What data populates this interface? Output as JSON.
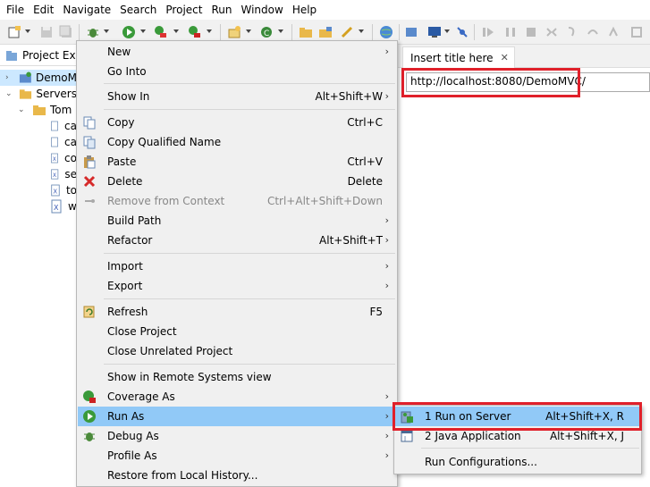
{
  "menubar": {
    "items": [
      {
        "label": "File"
      },
      {
        "label": "Edit"
      },
      {
        "label": "Navigate"
      },
      {
        "label": "Search"
      },
      {
        "label": "Project"
      },
      {
        "label": "Run"
      },
      {
        "label": "Window"
      },
      {
        "label": "Help"
      }
    ]
  },
  "explorer": {
    "tab_label": "Project Exp",
    "tree": [
      {
        "label": "DemoM",
        "icon": "project-icon",
        "expanded": false,
        "selected": true
      },
      {
        "label": "Servers",
        "icon": "folder-icon",
        "expanded": true
      },
      {
        "label": "Tom",
        "icon": "folder-icon",
        "expanded": true
      },
      {
        "label": "ca",
        "icon": "file-icon"
      },
      {
        "label": "ca",
        "icon": "file-icon"
      },
      {
        "label": "co",
        "icon": "xml-file-icon"
      },
      {
        "label": "se",
        "icon": "xml-file-icon"
      },
      {
        "label": "to",
        "icon": "xml-file-icon"
      },
      {
        "label": "w",
        "icon": "xml-file-icon"
      }
    ]
  },
  "editor": {
    "tab_label": "Insert title here",
    "close_label": "✕",
    "url": "http://localhost:8080/DemoMVC/"
  },
  "context_menu": {
    "items": [
      {
        "label": "New",
        "shortcut": "",
        "submenu": true
      },
      {
        "label": "Go Into",
        "shortcut": ""
      },
      {
        "label": "Show In",
        "shortcut": "Alt+Shift+W",
        "submenu": true
      },
      {
        "label": "Copy",
        "shortcut": "Ctrl+C",
        "icon": "copy-icon"
      },
      {
        "label": "Copy Qualified Name",
        "shortcut": "",
        "icon": "copy-qualified-icon"
      },
      {
        "label": "Paste",
        "shortcut": "Ctrl+V",
        "icon": "paste-icon"
      },
      {
        "label": "Delete",
        "shortcut": "Delete",
        "icon": "delete-icon"
      },
      {
        "label": "Remove from Context",
        "shortcut": "Ctrl+Alt+Shift+Down",
        "disabled": true,
        "icon": "remove-context-icon"
      },
      {
        "label": "Build Path",
        "shortcut": "",
        "submenu": true
      },
      {
        "label": "Refactor",
        "shortcut": "Alt+Shift+T",
        "submenu": true
      },
      {
        "label": "Import",
        "shortcut": "",
        "submenu": true
      },
      {
        "label": "Export",
        "shortcut": "",
        "submenu": true
      },
      {
        "label": "Refresh",
        "shortcut": "F5",
        "icon": "refresh-icon"
      },
      {
        "label": "Close Project",
        "shortcut": ""
      },
      {
        "label": "Close Unrelated Project",
        "shortcut": ""
      },
      {
        "label": "Show in Remote Systems view",
        "shortcut": ""
      },
      {
        "label": "Coverage As",
        "shortcut": "",
        "submenu": true,
        "icon": "coverage-icon"
      },
      {
        "label": "Run As",
        "shortcut": "",
        "submenu": true,
        "highlighted": true,
        "icon": "run-icon"
      },
      {
        "label": "Debug As",
        "shortcut": "",
        "submenu": true,
        "icon": "debug-icon"
      },
      {
        "label": "Profile As",
        "shortcut": "",
        "submenu": true
      },
      {
        "label": "Restore from Local History...",
        "shortcut": ""
      }
    ]
  },
  "run_as_submenu": {
    "items": [
      {
        "label": "1 Run on Server",
        "shortcut": "Alt+Shift+X, R",
        "highlighted": true,
        "icon": "server-run-icon"
      },
      {
        "label": "2 Java Application",
        "shortcut": "Alt+Shift+X, J",
        "icon": "java-app-icon"
      },
      {
        "label": "Run Configurations...",
        "shortcut": ""
      }
    ]
  },
  "colors": {
    "highlight": "#91c9f7",
    "annotation_border": "#e0202a",
    "menu_bg": "#f0f0f0",
    "selection": "#cce8ff"
  }
}
